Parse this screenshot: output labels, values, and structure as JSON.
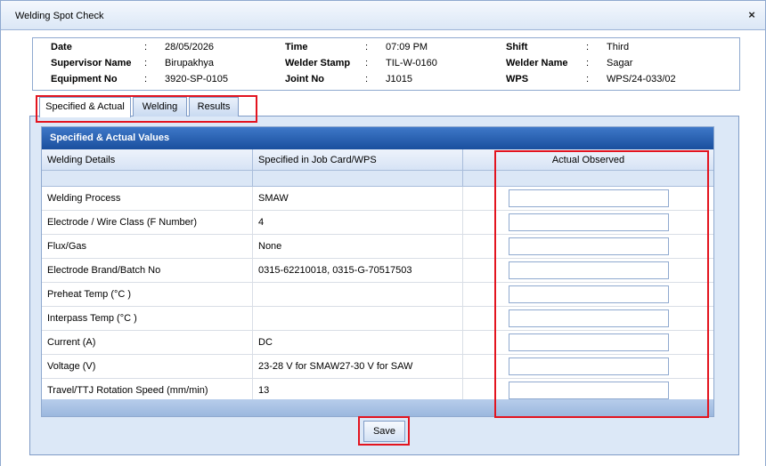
{
  "window": {
    "title": "Welding Spot Check",
    "close_icon": "×"
  },
  "header_info": {
    "date_label": "Date",
    "date_value": "28/05/2026",
    "time_label": "Time",
    "time_value": "07:09 PM",
    "shift_label": "Shift",
    "shift_value": "Third",
    "supervisor_label": "Supervisor Name",
    "supervisor_value": "Birupakhya",
    "welder_stamp_label": "Welder Stamp",
    "welder_stamp_value": "TIL-W-0160",
    "welder_name_label": "Welder Name",
    "welder_name_value": "Sagar",
    "equipment_label": "Equipment No",
    "equipment_value": "3920-SP-0105",
    "joint_label": "Joint No",
    "joint_value": "J1015",
    "wps_label": "WPS",
    "wps_value": "WPS/24-033/02",
    "separator": ":"
  },
  "tabs": [
    "Specified & Actual",
    "Welding",
    "Results"
  ],
  "grid": {
    "title": "Specified & Actual Values",
    "columns": [
      "Welding Details",
      "Specified in Job Card/WPS",
      "Actual Observed"
    ],
    "rows": [
      {
        "detail": "Welding Process",
        "specified": "SMAW",
        "observed": ""
      },
      {
        "detail": "Electrode / Wire Class (F Number)",
        "specified": "4",
        "observed": ""
      },
      {
        "detail": "Flux/Gas",
        "specified": "None",
        "observed": ""
      },
      {
        "detail": "Electrode Brand/Batch No",
        "specified": "0315-62210018, 0315-G-70517503",
        "observed": ""
      },
      {
        "detail": "Preheat Temp (°C )",
        "specified": "",
        "observed": ""
      },
      {
        "detail": "Interpass Temp (°C )",
        "specified": "",
        "observed": ""
      },
      {
        "detail": "Current (A)",
        "specified": "DC",
        "observed": ""
      },
      {
        "detail": "Voltage (V)",
        "specified": "23-28 V for SMAW27-30 V for SAW",
        "observed": ""
      },
      {
        "detail": "Travel/TTJ Rotation Speed (mm/min)",
        "specified": "13",
        "observed": ""
      }
    ]
  },
  "actions": {
    "save_label": "Save"
  },
  "colors": {
    "highlight": "#e3141f",
    "grid_title_bg": "#1a4f9e",
    "panel_bg": "#dce8f7"
  }
}
